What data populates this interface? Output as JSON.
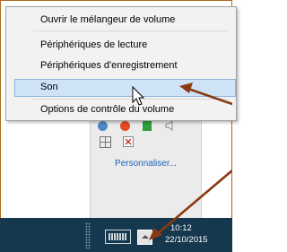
{
  "context_menu": {
    "items": [
      {
        "label": "Ouvrir le mélangeur de volume"
      },
      {
        "label": "Périphériques de lecture"
      },
      {
        "label": "Périphériques d'enregistrement"
      },
      {
        "label": "Son",
        "highlighted": true
      },
      {
        "label": "Options de contrôle du volume"
      }
    ]
  },
  "tray_flyout": {
    "customize_label": "Personnaliser...",
    "icons": [
      "settings-icon",
      "warning-icon",
      "green-status-icon",
      "volume-icon",
      "windows-flag-icon",
      "close-icon"
    ]
  },
  "taskbar": {
    "time": "10:12",
    "date": "22/10/2015",
    "keyboard_icon": "keyboard-icon",
    "show_hidden_icon": "chevron-up-icon"
  },
  "annotations": {
    "arrow_color": "#8a3a12"
  }
}
